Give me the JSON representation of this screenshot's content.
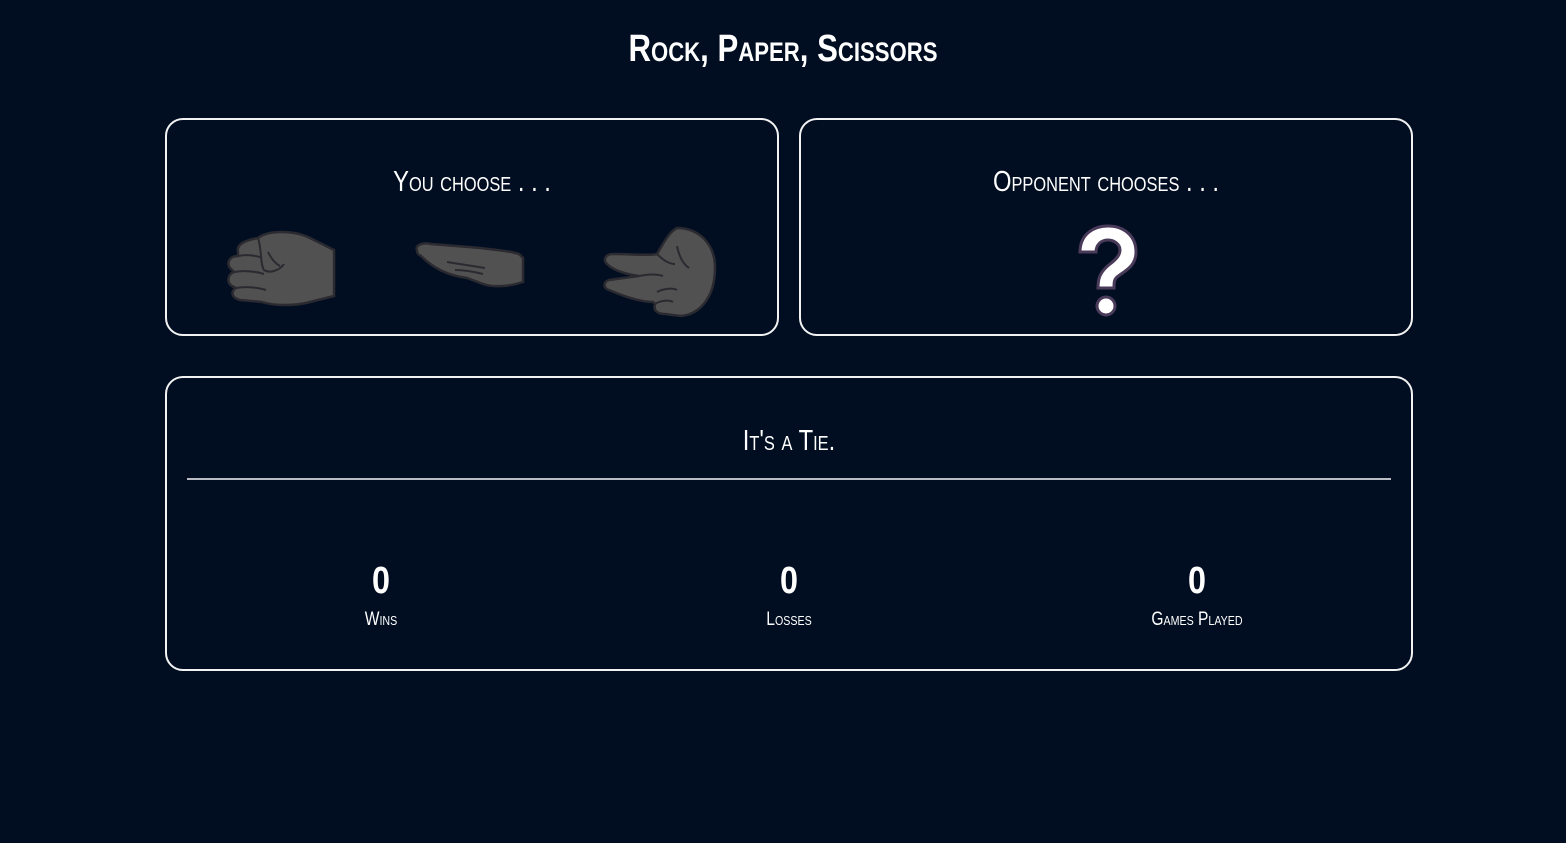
{
  "title": "Rock, Paper, Scissors",
  "player": {
    "heading": "You choose . . .",
    "choices": [
      {
        "name": "rock",
        "icon": "rock-hand-icon"
      },
      {
        "name": "paper",
        "icon": "paper-hand-icon"
      },
      {
        "name": "scissors",
        "icon": "scissors-hand-icon"
      }
    ]
  },
  "opponent": {
    "heading": "Opponent chooses . . .",
    "icon": "question-mark-icon"
  },
  "result": {
    "message": "It's a Tie.",
    "stats": [
      {
        "value": "0",
        "label": "Wins"
      },
      {
        "value": "0",
        "label": "Losses"
      },
      {
        "value": "0",
        "label": "Games Played"
      }
    ]
  },
  "colors": {
    "background": "#010e21",
    "border": "#f2f2f2",
    "hand_fill": "#525152",
    "hand_stroke": "#2a2a30",
    "divider": "#b9bcc2"
  }
}
